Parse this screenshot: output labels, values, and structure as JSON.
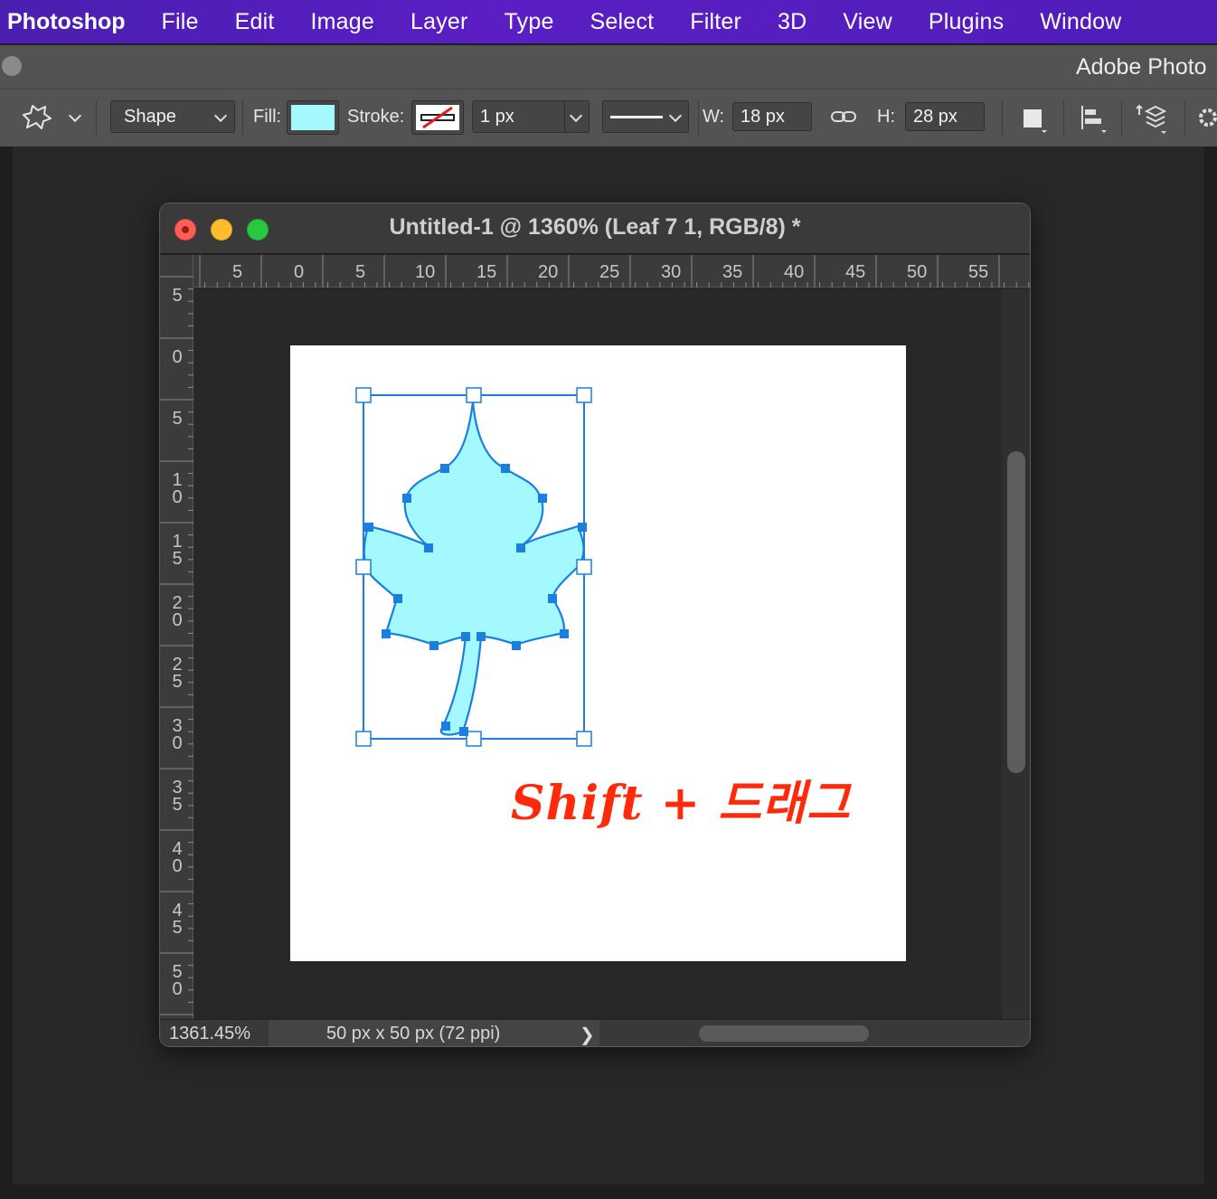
{
  "menubar": {
    "app_name": "Photoshop",
    "items": [
      "File",
      "Edit",
      "Image",
      "Layer",
      "Type",
      "Select",
      "Filter",
      "3D",
      "View",
      "Plugins",
      "Window"
    ]
  },
  "appbar": {
    "title": "Adobe Photo"
  },
  "options": {
    "tool_icon": "custom-shape-tool-icon",
    "mode": "Shape",
    "fill_label": "Fill:",
    "fill_color": "#a3f9ff",
    "stroke_label": "Stroke:",
    "stroke_width": "1 px",
    "w_label": "W:",
    "w_value": "18 px",
    "h_label": "H:",
    "h_value": "28 px"
  },
  "document": {
    "title": "Untitled-1 @ 1360% (Leaf 7 1, RGB/8) *",
    "ruler_h": [
      "5",
      "0",
      "5",
      "10",
      "15",
      "20",
      "25",
      "30",
      "35",
      "40",
      "45",
      "50",
      "55"
    ],
    "ruler_v": [
      "5",
      "0",
      "5",
      "10",
      "15",
      "20",
      "25",
      "30",
      "35",
      "40",
      "45",
      "50"
    ],
    "zoom": "1361.45%",
    "info": "50 px x 50 px (72 ppi)",
    "caption": "Shift + 드래그",
    "caption_color": "#ff2a0a",
    "shape_fill": "#a3f9ff",
    "path_color": "#1a7fe0"
  }
}
